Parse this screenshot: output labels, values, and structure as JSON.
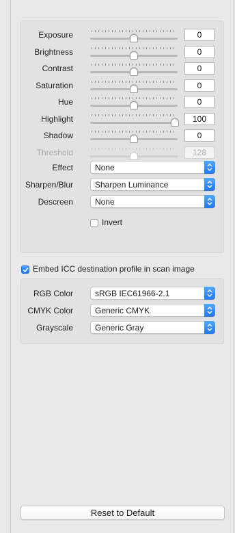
{
  "adjustments": [
    {
      "label": "Exposure",
      "value": "0",
      "level": 0.5,
      "enabled": true
    },
    {
      "label": "Brightness",
      "value": "0",
      "level": 0.5,
      "enabled": true
    },
    {
      "label": "Contrast",
      "value": "0",
      "level": 0.5,
      "enabled": true
    },
    {
      "label": "Saturation",
      "value": "0",
      "level": 0.5,
      "enabled": true
    },
    {
      "label": "Hue",
      "value": "0",
      "level": 0.5,
      "enabled": true
    },
    {
      "label": "Highlight",
      "value": "100",
      "level": 1.0,
      "enabled": true
    },
    {
      "label": "Shadow",
      "value": "0",
      "level": 0.5,
      "enabled": true
    },
    {
      "label": "Threshold",
      "value": "128",
      "level": 0.5,
      "enabled": false
    }
  ],
  "options": {
    "effect": {
      "label": "Effect",
      "value": "None"
    },
    "sharpen_blur": {
      "label": "Sharpen/Blur",
      "value": "Sharpen Luminance"
    },
    "descreen": {
      "label": "Descreen",
      "value": "None"
    },
    "invert": {
      "label": "Invert",
      "checked": false
    }
  },
  "embed_icc": {
    "label": "Embed ICC destination profile in scan image",
    "checked": true
  },
  "profiles": {
    "rgb": {
      "label": "RGB Color",
      "value": "sRGB IEC61966-2.1"
    },
    "cmyk": {
      "label": "CMYK Color",
      "value": "Generic CMYK"
    },
    "gray": {
      "label": "Grayscale",
      "value": "Generic Gray"
    }
  },
  "reset_label": "Reset to Default",
  "colors": {
    "accent": "#2f86f6",
    "panel": "#e2e2e2",
    "background": "#e9e9e9"
  }
}
